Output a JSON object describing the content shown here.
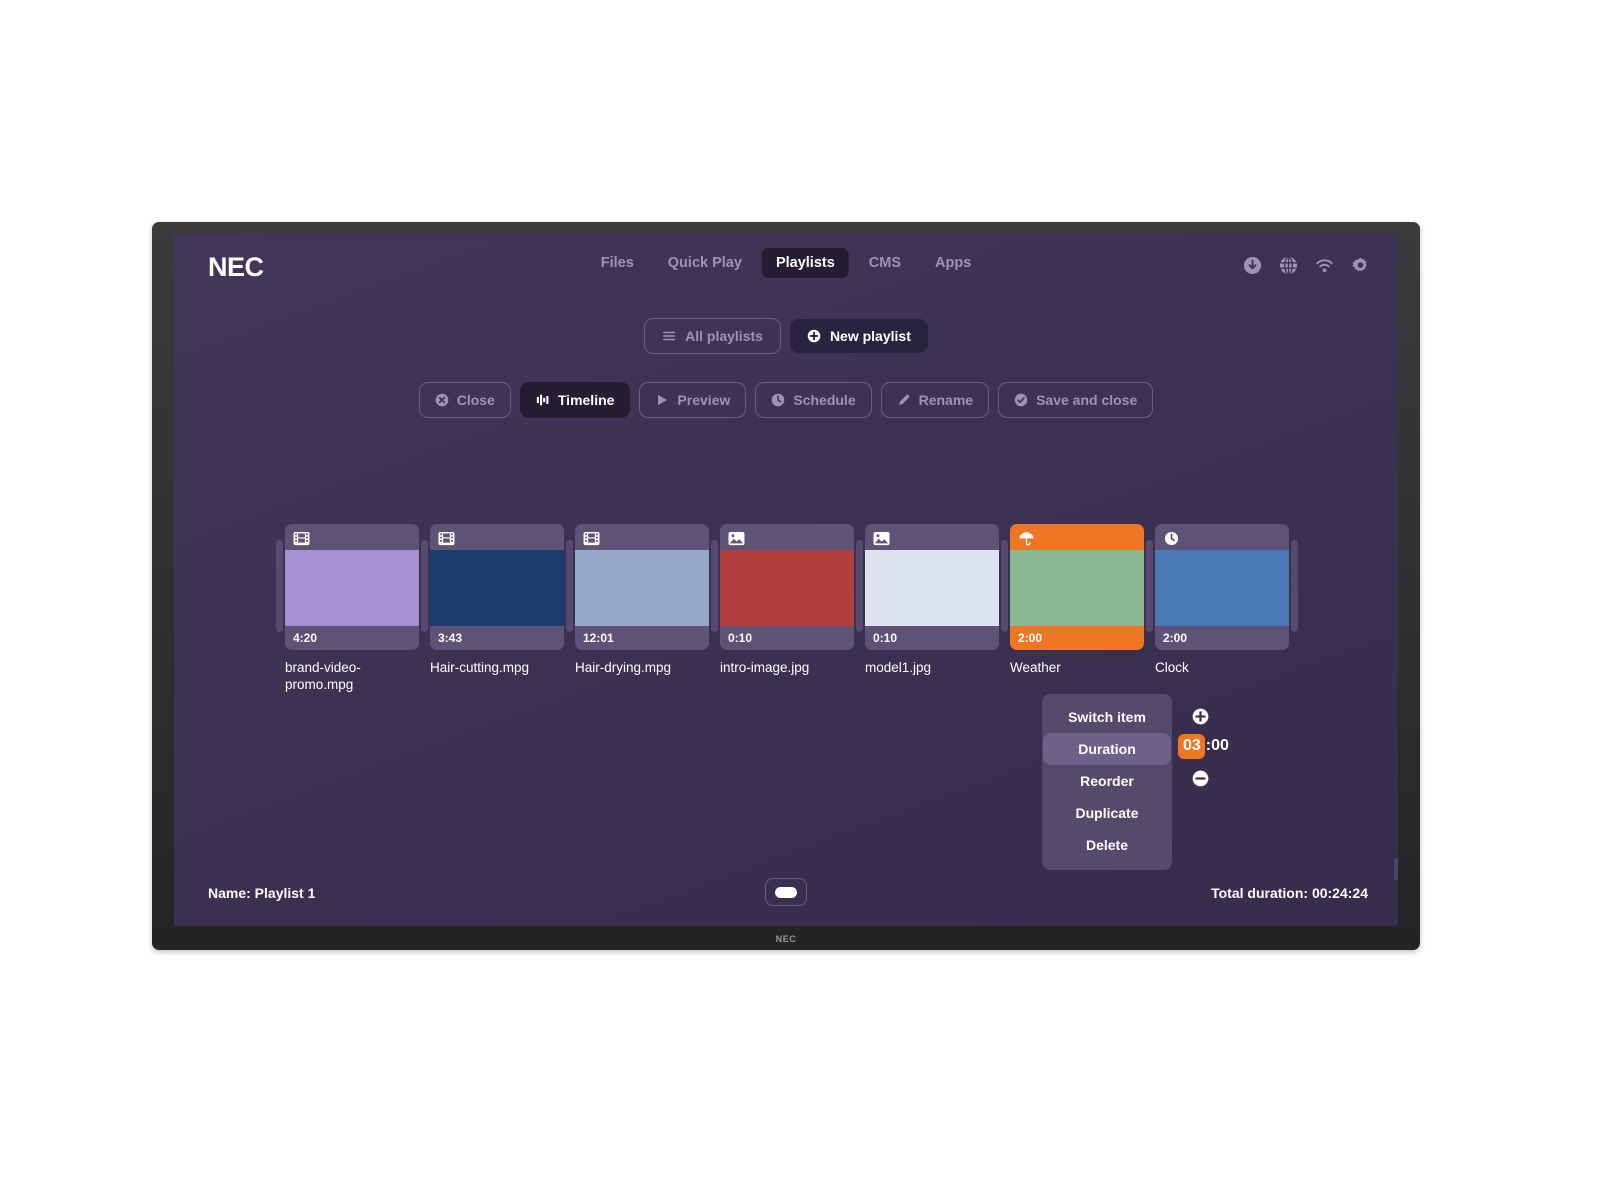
{
  "device": {
    "bezel_brand": "NEC"
  },
  "header": {
    "logo": "NEC",
    "nav": [
      {
        "label": "Files",
        "active": false
      },
      {
        "label": "Quick Play",
        "active": false
      },
      {
        "label": "Playlists",
        "active": true
      },
      {
        "label": "CMS",
        "active": false
      },
      {
        "label": "Apps",
        "active": false
      }
    ],
    "icons": [
      {
        "name": "download-icon"
      },
      {
        "name": "globe-icon"
      },
      {
        "name": "wifi-icon"
      },
      {
        "name": "gear-icon"
      }
    ]
  },
  "playlist_bar": {
    "all_playlists": "All playlists",
    "new_playlist": "New playlist"
  },
  "toolbar": {
    "close": "Close",
    "timeline": "Timeline",
    "preview": "Preview",
    "schedule": "Schedule",
    "rename": "Rename",
    "save_and_close": "Save and close"
  },
  "timeline": {
    "items": [
      {
        "label": "brand-video-promo.mpg",
        "duration": "4:20",
        "icon": "film-icon",
        "thumb_color": "#a391d1",
        "selected": false
      },
      {
        "label": "Hair-cutting.mpg",
        "duration": "3:43",
        "icon": "film-icon",
        "thumb_color": "#1c3c6e",
        "selected": false
      },
      {
        "label": "Hair-drying.mpg",
        "duration": "12:01",
        "icon": "film-icon",
        "thumb_color": "#95aac9",
        "selected": false
      },
      {
        "label": "intro-image.jpg",
        "duration": "0:10",
        "icon": "image-icon",
        "thumb_color": "#b33f3f",
        "selected": false
      },
      {
        "label": "model1.jpg",
        "duration": "0:10",
        "icon": "image-icon",
        "thumb_color": "#dde2f0",
        "selected": false
      },
      {
        "label": "Weather",
        "duration": "2:00",
        "icon": "umbrella-icon",
        "thumb_color": "#8cb795",
        "selected": true
      },
      {
        "label": "Clock",
        "duration": "2:00",
        "icon": "clock-icon",
        "thumb_color": "#4a7ab5",
        "selected": false
      }
    ]
  },
  "context_menu": {
    "items": [
      {
        "label": "Switch item",
        "highlight": false
      },
      {
        "label": "Duration",
        "highlight": true
      },
      {
        "label": "Reorder",
        "highlight": false
      },
      {
        "label": "Duplicate",
        "highlight": false
      },
      {
        "label": "Delete",
        "highlight": false
      }
    ],
    "duration_hours": "03",
    "duration_rest": ":00",
    "plus_icon": "plus-circle-icon",
    "minus_icon": "minus-circle-icon"
  },
  "status_bar": {
    "name": "Name: Playlist 1",
    "total_duration": "Total duration: 00:24:24"
  },
  "colors": {
    "accent_orange": "#ef7622",
    "screen_bg": "#3d3253",
    "card_bg": "#5e5377",
    "muted_text": "#9e93b4"
  }
}
